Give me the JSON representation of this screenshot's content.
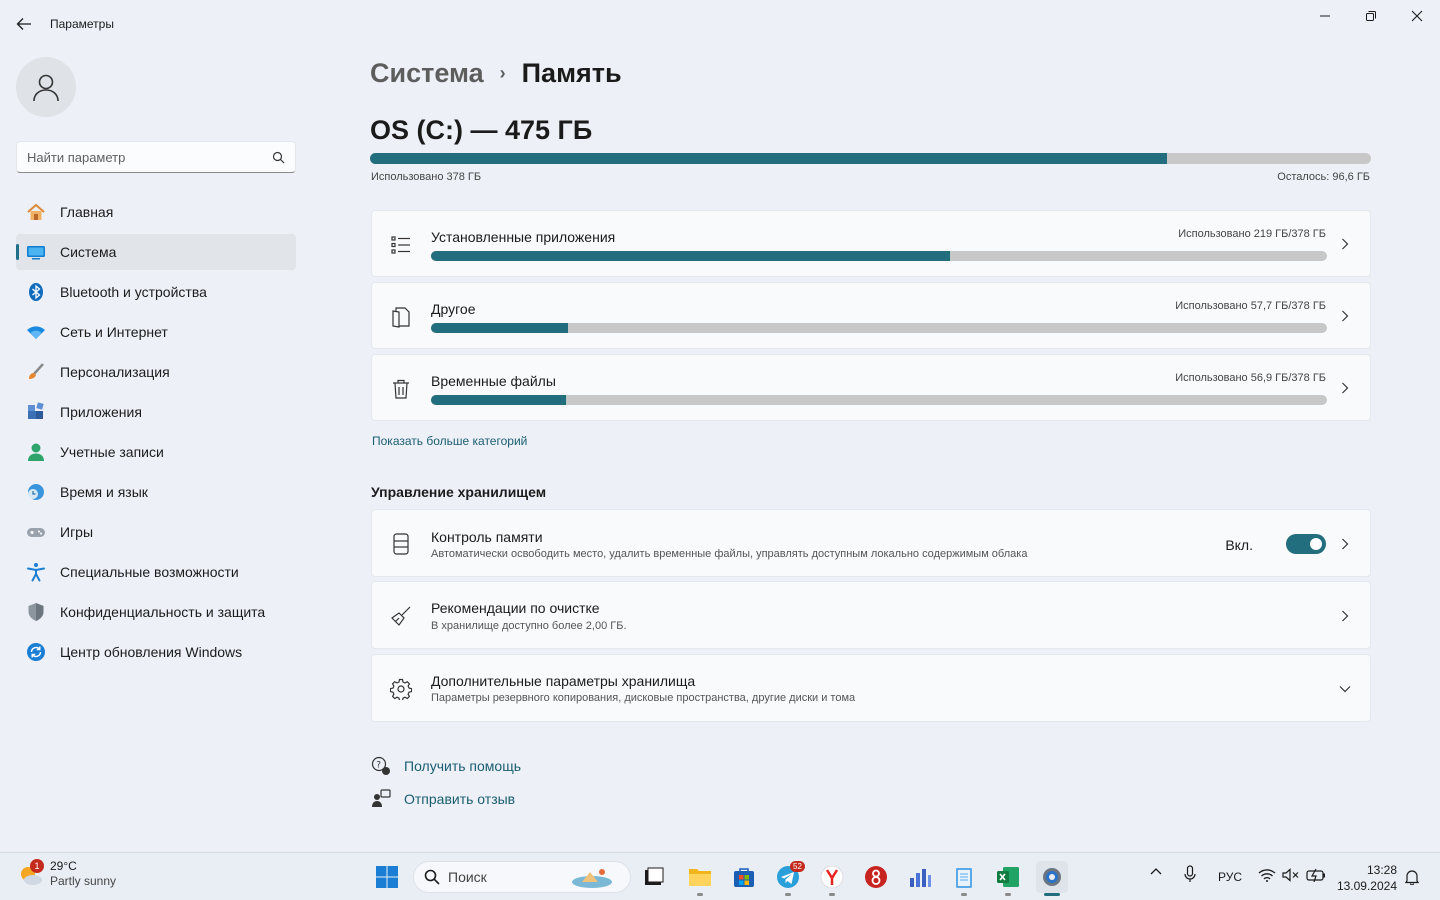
{
  "window": {
    "title": "Параметры",
    "controls": [
      "minimize-icon",
      "maximize-icon",
      "close-icon"
    ]
  },
  "sidebar": {
    "search_placeholder": "Найти параметр",
    "items": [
      {
        "label": "Главная",
        "icon": "home-icon",
        "active": false
      },
      {
        "label": "Система",
        "icon": "system-icon",
        "active": true
      },
      {
        "label": "Bluetooth и устройства",
        "icon": "bluetooth-icon",
        "active": false
      },
      {
        "label": "Сеть и Интернет",
        "icon": "wifi-icon",
        "active": false
      },
      {
        "label": "Персонализация",
        "icon": "brush-icon",
        "active": false
      },
      {
        "label": "Приложения",
        "icon": "apps-icon",
        "active": false
      },
      {
        "label": "Учетные записи",
        "icon": "accounts-icon",
        "active": false
      },
      {
        "label": "Время и язык",
        "icon": "time-language-icon",
        "active": false
      },
      {
        "label": "Игры",
        "icon": "gamepad-icon",
        "active": false
      },
      {
        "label": "Специальные возможности",
        "icon": "accessibility-icon",
        "active": false
      },
      {
        "label": "Конфиденциальность и защита",
        "icon": "shield-icon",
        "active": false
      },
      {
        "label": "Центр обновления Windows",
        "icon": "update-icon",
        "active": false
      }
    ]
  },
  "breadcrumb": {
    "parent": "Система",
    "separator": "›",
    "current": "Память"
  },
  "drive": {
    "title": "OS (C:) — 475 ГБ",
    "used_fraction": 0.796,
    "used_label": "Использовано 378 ГБ",
    "free_label": "Осталось: 96,6 ГБ"
  },
  "categories": [
    {
      "title": "Установленные приложения",
      "usage": "Использовано 219 ГБ/378 ГБ",
      "fraction": 0.579,
      "icon": "list-icon"
    },
    {
      "title": "Другое",
      "usage": "Использовано 57,7 ГБ/378 ГБ",
      "fraction": 0.153,
      "icon": "document-icon"
    },
    {
      "title": "Временные файлы",
      "usage": "Использовано 56,9 ГБ/378 ГБ",
      "fraction": 0.151,
      "icon": "trash-icon"
    }
  ],
  "more_categories": "Показать больше категорий",
  "management": {
    "title": "Управление хранилищем",
    "items": [
      {
        "title": "Контроль памяти",
        "subtitle": "Автоматически освободить место, удалить временные файлы, управлять доступным локально содержимым облака",
        "toggle_label": "Вкл.",
        "toggle_on": true,
        "icon": "storage-sense-icon"
      },
      {
        "title": "Рекомендации по очистке",
        "subtitle": "В хранилище доступно более 2,00 ГБ.",
        "icon": "broom-icon"
      },
      {
        "title": "Дополнительные параметры хранилища",
        "subtitle": "Параметры резервного копирования, дисковые пространства, другие диски и тома",
        "icon": "gear-icon"
      }
    ]
  },
  "help": {
    "get_help": "Получить помощь",
    "feedback": "Отправить отзыв"
  },
  "taskbar": {
    "weather": {
      "temp": "29°C",
      "condition": "Partly sunny",
      "badge": "1"
    },
    "search_placeholder": "Поиск",
    "telegram_badge": "52",
    "language": "РУС",
    "time": "13:28",
    "date": "13.09.2024"
  },
  "colors": {
    "accent": "#236e7e",
    "bar_bg": "#c8c8c8",
    "link": "#1a5d70"
  }
}
